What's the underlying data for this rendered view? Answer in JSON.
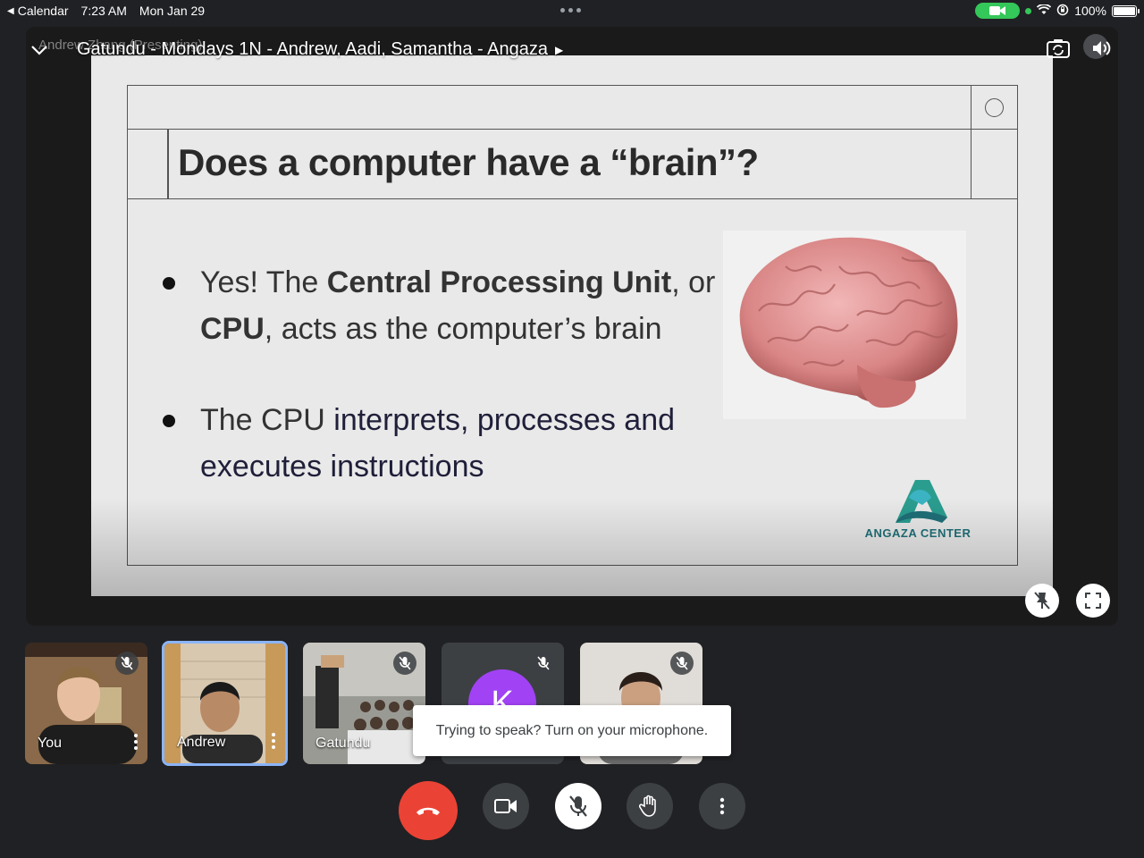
{
  "status_bar": {
    "back_label": "Calendar",
    "time": "7:23 AM",
    "date": "Mon Jan 29",
    "battery": "100%"
  },
  "meeting": {
    "title": "Gatundu - Mondays 1N - Andrew, Aadi, Samantha - Angaza",
    "presenter_overlay": "Andrew Zhang (Presenting)"
  },
  "slide": {
    "title": "Does a computer have a “brain”?",
    "bullet1": {
      "p1": "Yes! The ",
      "b1": "Central Processing Unit",
      "p2": ", or ",
      "b2": "CPU",
      "p3": ", acts as the computer’s brain"
    },
    "bullet2": {
      "p1": "The CPU ",
      "em": "interprets, processes and executes instructions"
    },
    "logo_text": "ANGAZA CENTER"
  },
  "participants": [
    {
      "name": "You"
    },
    {
      "name": "Andrew"
    },
    {
      "name": "Gatundu"
    },
    {
      "name": "",
      "initial": "K"
    },
    {
      "name": ""
    }
  ],
  "tooltip": "Trying to speak? Turn on your microphone.",
  "colors": {
    "hangup": "#ea4335",
    "active_tile": "#8ab4f8",
    "avatar": "#a142f4",
    "logo": "#1f6f78"
  }
}
